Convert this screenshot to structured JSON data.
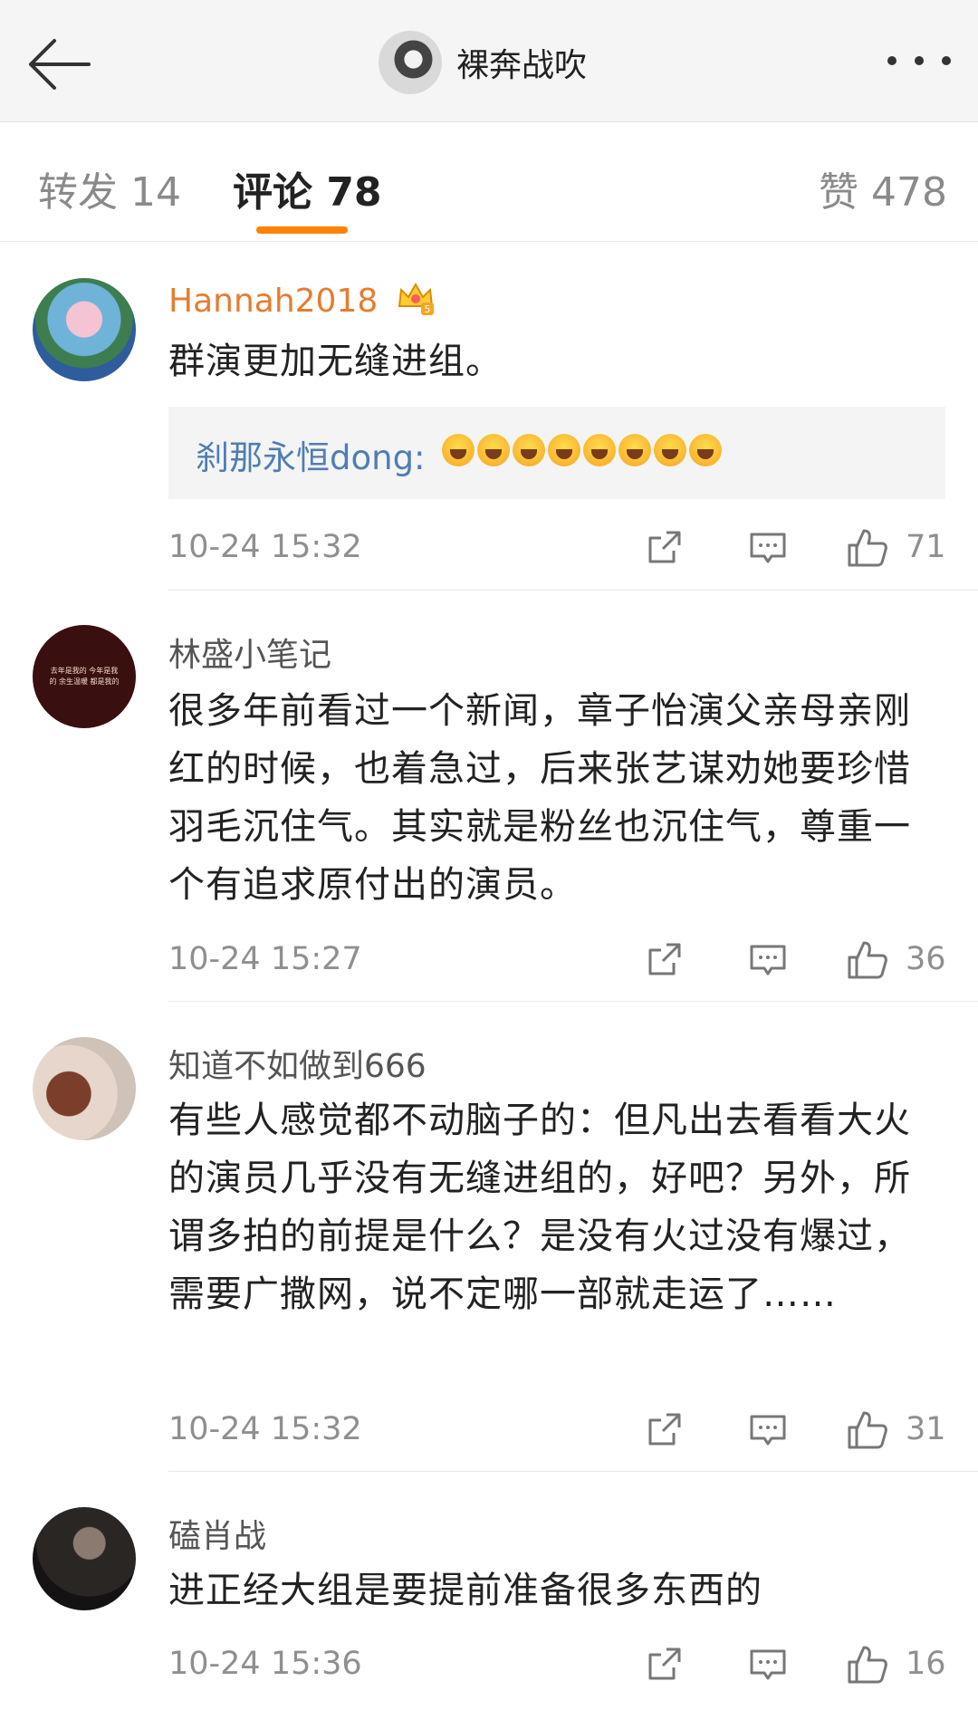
{
  "header": {
    "title": "裸奔战吹"
  },
  "tabs": [
    {
      "label": "转发 14"
    },
    {
      "label": "评论 78"
    },
    {
      "label": "赞 478"
    }
  ],
  "comments": [
    {
      "username": "Hannah2018",
      "text": "群演更加无缝进组。",
      "reply": {
        "user": "刹那永恒dong:",
        "emoji_count": 8
      },
      "time": "10-24 15:32",
      "likes": "71"
    },
    {
      "username": "林盛小笔记",
      "text": "很多年前看过一个新闻，章子怡演父亲母亲刚红的时候，也着急过，后来张艺谋劝她要珍惜羽毛沉住气。其实就是粉丝也沉住气，尊重一个有追求原付出的演员。",
      "avatar_text": "去年是我的 今年是我的 余生温暖 都是我的",
      "time": "10-24 15:27",
      "likes": "36"
    },
    {
      "username": "知道不如做到666",
      "text": "有些人感觉都不动脑子的：但凡出去看看大火的演员几乎没有无缝进组的，好吧？另外，所谓多拍的前提是什么？是没有火过没有爆过，需要广撒网，说不定哪一部就走运了……",
      "time": "10-24 15:32",
      "likes": "31"
    },
    {
      "username": "磕肖战",
      "text": "进正经大组是要提前准备很多东西的",
      "time": "10-24 15:36",
      "likes": "16"
    }
  ]
}
